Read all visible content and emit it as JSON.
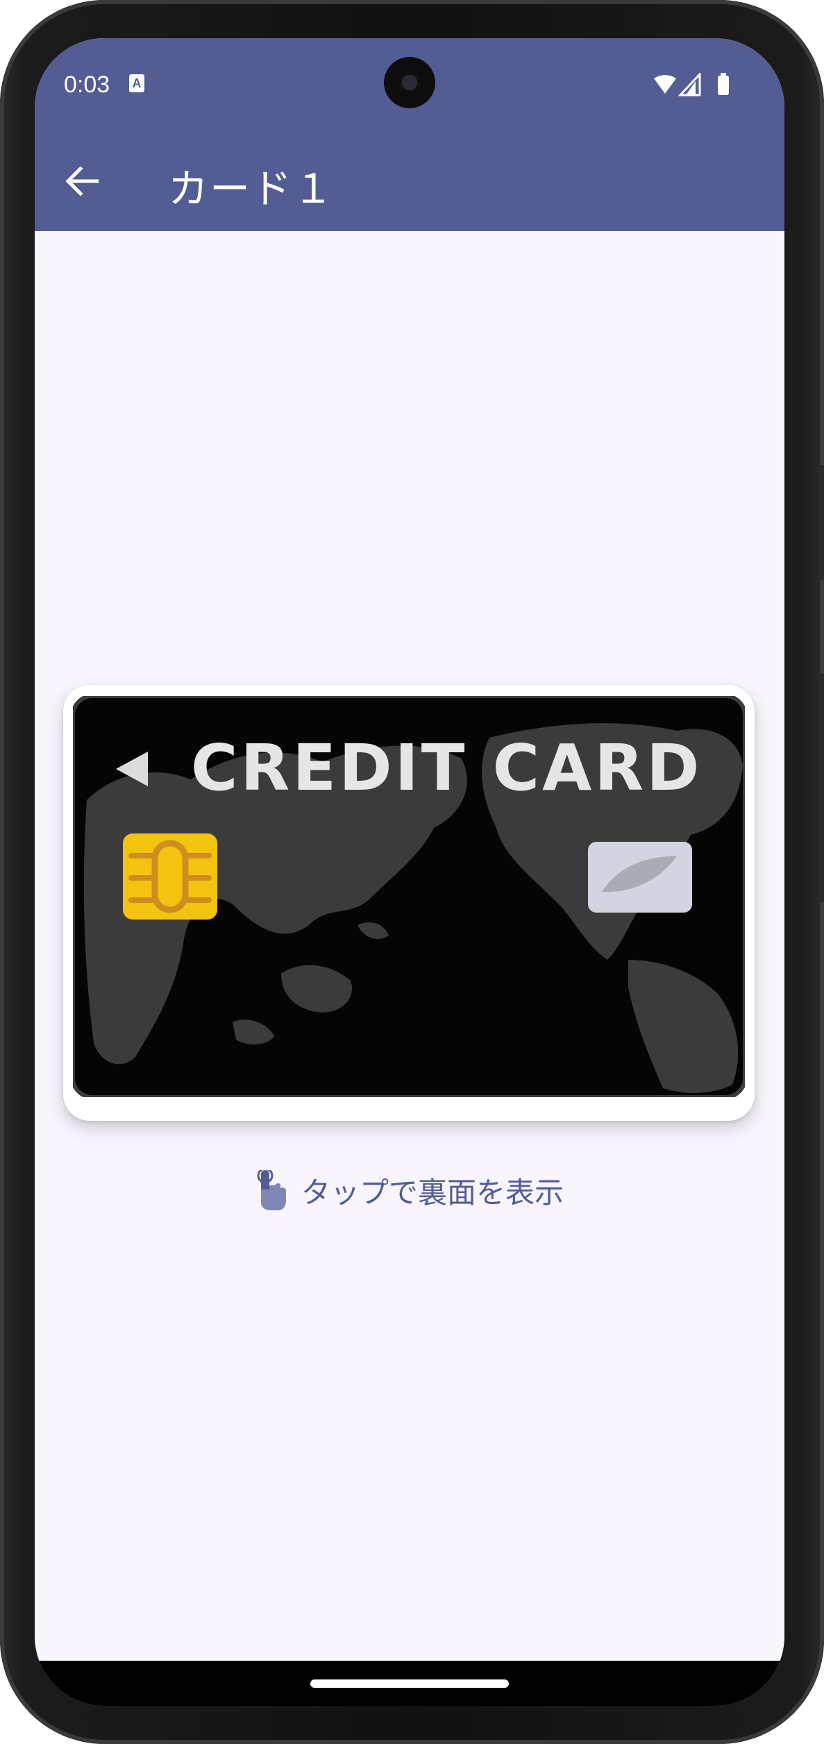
{
  "status_bar": {
    "time": "0:03",
    "a_icon_label": "A",
    "icons": [
      "wifi-icon",
      "signal-icon",
      "battery-icon"
    ]
  },
  "app_bar": {
    "back_icon": "arrow-left-icon",
    "title": "カード１"
  },
  "card": {
    "image_alt": "CREDIT CARD",
    "printed_text": "CREDIT CARD"
  },
  "hint": {
    "icon": "tap-hand-icon",
    "text": "タップで裏面を表示"
  },
  "colors": {
    "primary": "#535d93",
    "background": "#f8f5fc",
    "card_black": "#050505",
    "chip_gold": "#f2c40f"
  }
}
